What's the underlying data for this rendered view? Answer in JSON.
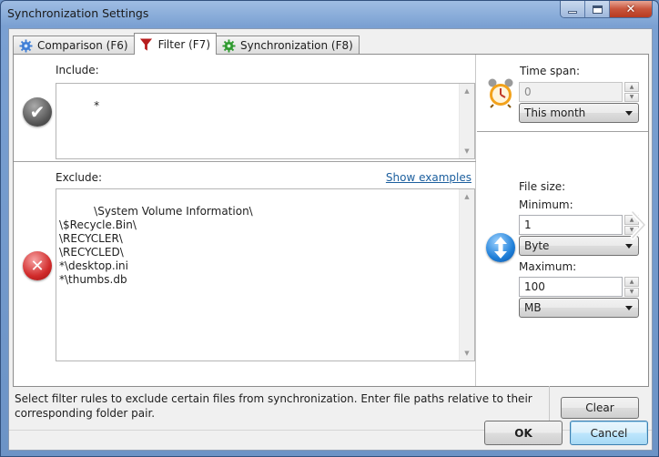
{
  "window": {
    "title": "Synchronization Settings",
    "controls": {
      "minimize": "minimize",
      "maximize": "maximize",
      "close": "✕"
    }
  },
  "tabs": [
    {
      "label": "Comparison (F6)",
      "icon": "gear-blue-icon",
      "active": false
    },
    {
      "label": "Filter (F7)",
      "icon": "funnel-icon",
      "active": true
    },
    {
      "label": "Synchronization (F8)",
      "icon": "gear-green-icon",
      "active": false
    }
  ],
  "filter": {
    "include": {
      "label": "Include:",
      "value": "*"
    },
    "exclude": {
      "label": "Exclude:",
      "show_examples": "Show examples",
      "value": "\\System Volume Information\\\n\\$Recycle.Bin\\\n\\RECYCLER\\\n\\RECYCLED\\\n*\\desktop.ini\n*\\thumbs.db"
    },
    "time_span": {
      "label": "Time span:",
      "value": "0",
      "selected": "This month"
    },
    "file_size": {
      "label": "File size:",
      "minimum_label": "Minimum:",
      "minimum_value": "1",
      "minimum_unit": "Byte",
      "maximum_label": "Maximum:",
      "maximum_value": "100",
      "maximum_unit": "MB"
    },
    "hint": "Select filter rules to exclude certain files from synchronization. Enter file paths relative to their corresponding folder pair.",
    "clear_label": "Clear"
  },
  "footer": {
    "ok_label": "OK",
    "cancel_label": "Cancel"
  }
}
